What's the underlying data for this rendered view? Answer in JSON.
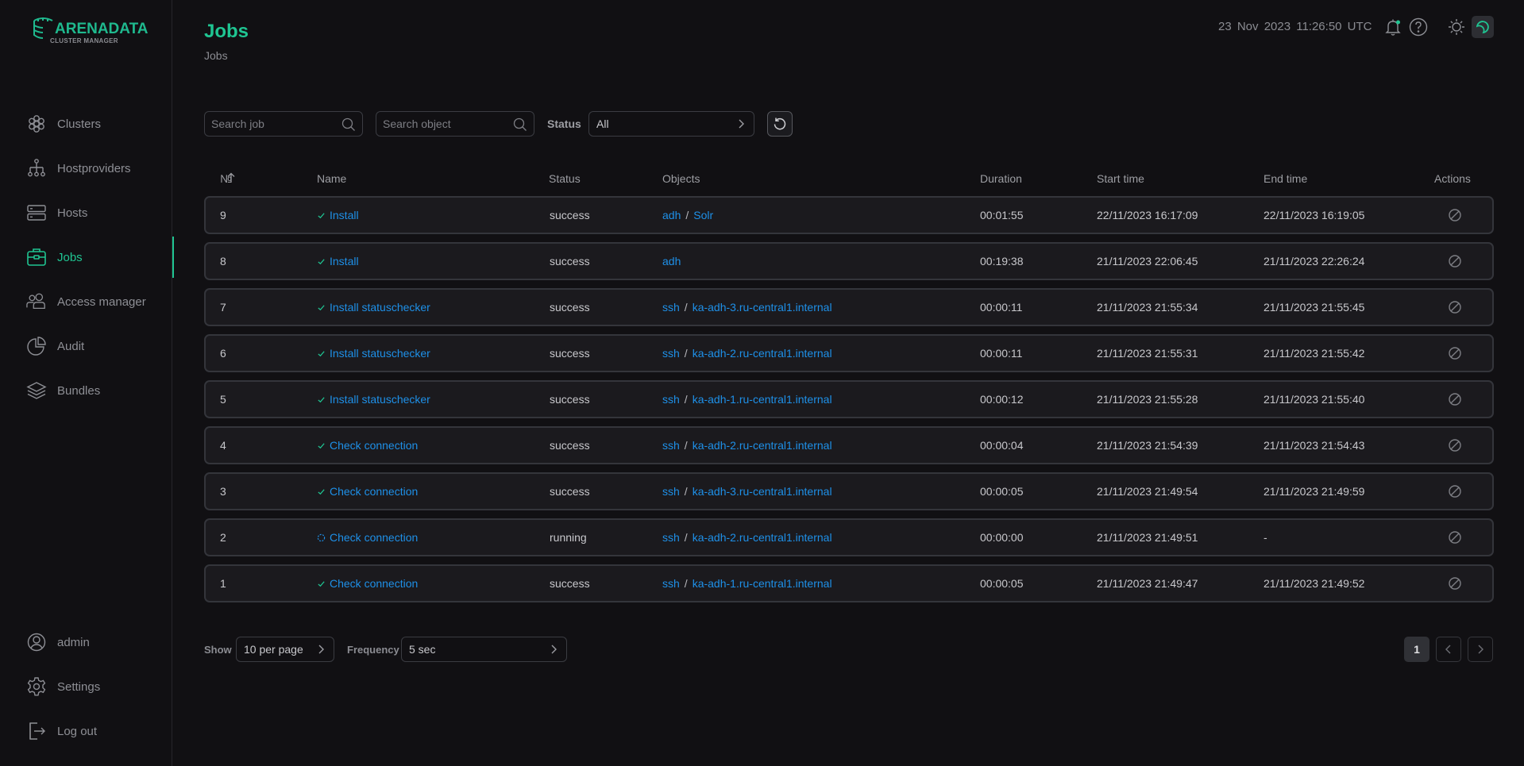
{
  "app": {
    "logo_title": "ARENADATA",
    "logo_subtitle": "CLUSTER MANAGER",
    "accent_color": "#1fc592",
    "link_color": "#1e90e8"
  },
  "sidebar": {
    "items": [
      {
        "label": "Clusters",
        "icon": "clusters-icon",
        "active": false
      },
      {
        "label": "Hostproviders",
        "icon": "hostproviders-icon",
        "active": false
      },
      {
        "label": "Hosts",
        "icon": "hosts-icon",
        "active": false
      },
      {
        "label": "Jobs",
        "icon": "jobs-icon",
        "active": true
      },
      {
        "label": "Access manager",
        "icon": "access-manager-icon",
        "active": false
      },
      {
        "label": "Audit",
        "icon": "audit-icon",
        "active": false
      },
      {
        "label": "Bundles",
        "icon": "bundles-icon",
        "active": false
      }
    ],
    "bottom_items": [
      {
        "label": "admin",
        "icon": "user-icon"
      },
      {
        "label": "Settings",
        "icon": "gear-icon"
      },
      {
        "label": "Log out",
        "icon": "logout-icon"
      }
    ]
  },
  "header": {
    "title": "Jobs",
    "breadcrumb": "Jobs",
    "datetime": "23 Nov 2023  11:26:50  UTC"
  },
  "filters": {
    "search_job_placeholder": "Search job",
    "search_object_placeholder": "Search object",
    "status_label": "Status",
    "status_value": "All"
  },
  "table": {
    "columns": [
      "№",
      "Name",
      "Status",
      "Objects",
      "Duration",
      "Start time",
      "End time",
      "Actions"
    ],
    "sort": {
      "column": "№",
      "direction": "ascending-arrow"
    },
    "rows": [
      {
        "id": "9",
        "name": "Install",
        "state": "success",
        "status": "success",
        "objects": [
          "adh",
          "Solr"
        ],
        "duration": "00:01:55",
        "start": "22/11/2023 16:17:09",
        "end": "22/11/2023 16:19:05"
      },
      {
        "id": "8",
        "name": "Install",
        "state": "success",
        "status": "success",
        "objects": [
          "adh"
        ],
        "duration": "00:19:38",
        "start": "21/11/2023 22:06:45",
        "end": "21/11/2023 22:26:24"
      },
      {
        "id": "7",
        "name": "Install statuschecker",
        "state": "success",
        "status": "success",
        "objects": [
          "ssh",
          "ka-adh-3.ru-central1.internal"
        ],
        "duration": "00:00:11",
        "start": "21/11/2023 21:55:34",
        "end": "21/11/2023 21:55:45"
      },
      {
        "id": "6",
        "name": "Install statuschecker",
        "state": "success",
        "status": "success",
        "objects": [
          "ssh",
          "ka-adh-2.ru-central1.internal"
        ],
        "duration": "00:00:11",
        "start": "21/11/2023 21:55:31",
        "end": "21/11/2023 21:55:42"
      },
      {
        "id": "5",
        "name": "Install statuschecker",
        "state": "success",
        "status": "success",
        "objects": [
          "ssh",
          "ka-adh-1.ru-central1.internal"
        ],
        "duration": "00:00:12",
        "start": "21/11/2023 21:55:28",
        "end": "21/11/2023 21:55:40"
      },
      {
        "id": "4",
        "name": "Check connection",
        "state": "success",
        "status": "success",
        "objects": [
          "ssh",
          "ka-adh-2.ru-central1.internal"
        ],
        "duration": "00:00:04",
        "start": "21/11/2023 21:54:39",
        "end": "21/11/2023 21:54:43"
      },
      {
        "id": "3",
        "name": "Check connection",
        "state": "success",
        "status": "success",
        "objects": [
          "ssh",
          "ka-adh-3.ru-central1.internal"
        ],
        "duration": "00:00:05",
        "start": "21/11/2023 21:49:54",
        "end": "21/11/2023 21:49:59"
      },
      {
        "id": "2",
        "name": "Check connection",
        "state": "running",
        "status": "running",
        "objects": [
          "ssh",
          "ka-adh-2.ru-central1.internal"
        ],
        "duration": "00:00:00",
        "start": "21/11/2023 21:49:51",
        "end": "-"
      },
      {
        "id": "1",
        "name": "Check connection",
        "state": "success",
        "status": "success",
        "objects": [
          "ssh",
          "ka-adh-1.ru-central1.internal"
        ],
        "duration": "00:00:05",
        "start": "21/11/2023 21:49:47",
        "end": "21/11/2023 21:49:52"
      }
    ]
  },
  "footer": {
    "show_label": "Show",
    "per_page": "10 per page",
    "frequency_label": "Frequency",
    "frequency": "5 sec",
    "current_page": "1"
  }
}
